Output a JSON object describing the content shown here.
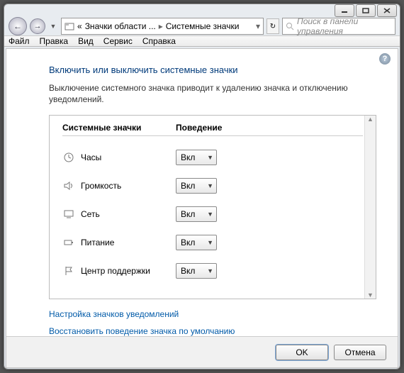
{
  "breadcrumb": {
    "prefix": "«",
    "part1": "Значки области ...",
    "part2": "Системные значки"
  },
  "search": {
    "placeholder": "Поиск в панели управления"
  },
  "menubar": {
    "file": "Файл",
    "edit": "Правка",
    "view": "Вид",
    "tools": "Сервис",
    "help": "Справка"
  },
  "page": {
    "title": "Включить или выключить системные значки",
    "description": "Выключение системного значка приводит к удалению значка и отключению уведомлений."
  },
  "columns": {
    "icons": "Системные значки",
    "behavior": "Поведение"
  },
  "rows": [
    {
      "key": "clock",
      "label": "Часы",
      "value": "Вкл"
    },
    {
      "key": "volume",
      "label": "Громкость",
      "value": "Вкл"
    },
    {
      "key": "network",
      "label": "Сеть",
      "value": "Вкл"
    },
    {
      "key": "power",
      "label": "Питание",
      "value": "Вкл"
    },
    {
      "key": "action",
      "label": "Центр поддержки",
      "value": "Вкл"
    }
  ],
  "links": {
    "customize": "Настройка значков уведомлений",
    "restore": "Восстановить поведение значка по умолчанию"
  },
  "buttons": {
    "ok": "OK",
    "cancel": "Отмена"
  }
}
